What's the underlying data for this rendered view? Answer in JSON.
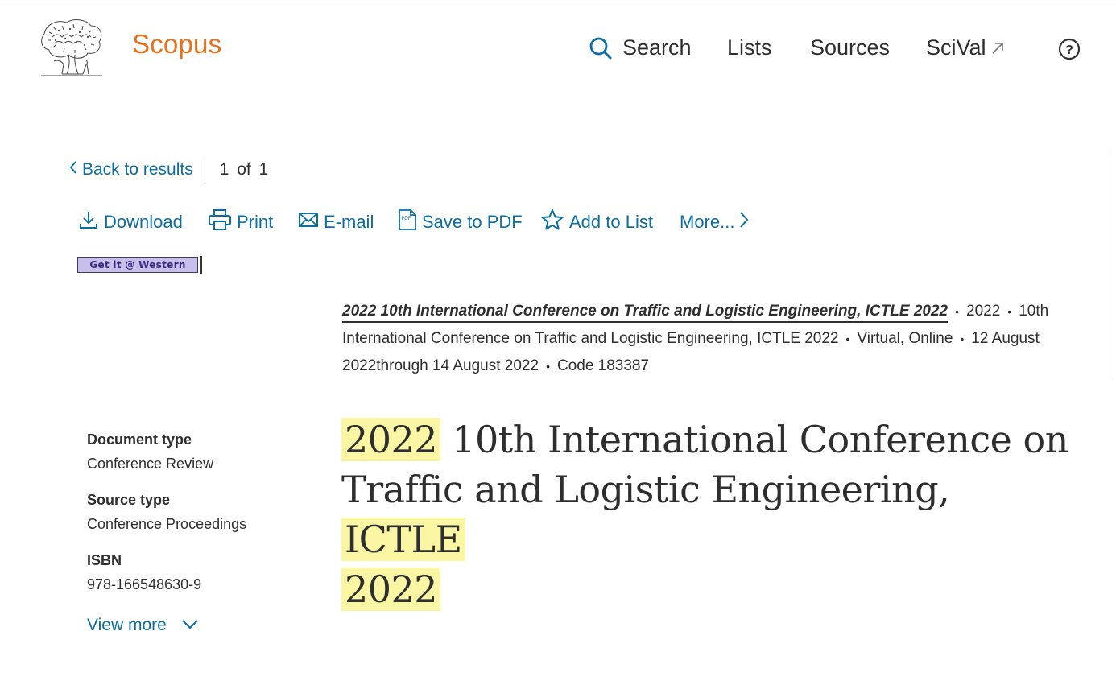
{
  "header": {
    "brand": "Scopus",
    "nav": [
      {
        "label": "Search"
      },
      {
        "label": "Lists"
      },
      {
        "label": "Sources"
      },
      {
        "label": "SciVal"
      }
    ]
  },
  "navigation": {
    "back_label": "Back to results",
    "pager": "1 of 1"
  },
  "toolbar": {
    "download": "Download",
    "print": "Print",
    "email": "E-mail",
    "save_pdf": "Save to PDF",
    "add_to_list": "Add to List",
    "more": "More..."
  },
  "getit_label": "Get it @ Western",
  "source": {
    "title": "2022 10th International Conference on Traffic and Logistic Engineering, ICTLE 2022",
    "year": "2022",
    "conference": "10th International Conference on Traffic and Logistic Engineering, ICTLE 2022",
    "location": "Virtual, Online",
    "dates": "12 August 2022through 14 August 2022",
    "code": "Code 183387"
  },
  "document": {
    "title_parts": {
      "p1": "2022",
      "p2": " 10th International Conference on Traffic and Logistic Engineering, ",
      "p3": "ICTLE",
      "p4": "2022"
    },
    "highlight_color": "#fbf6a4"
  },
  "meta": {
    "document_type_label": "Document type",
    "document_type": "Conference Review",
    "source_type_label": "Source type",
    "source_type": "Conference Proceedings",
    "isbn_label": "ISBN",
    "isbn": "978-166548630-9",
    "view_more": "View more"
  },
  "colors": {
    "brand": "#e9711c",
    "link": "#0a6ea3",
    "text": "#2e2e2e"
  },
  "icons": [
    "elsevier-tree-logo",
    "search-icon",
    "external-link-icon",
    "help-icon",
    "chevron-left-icon",
    "download-icon",
    "print-icon",
    "email-icon",
    "pdf-icon",
    "star-icon",
    "chevron-right-icon",
    "chevron-down-icon"
  ]
}
